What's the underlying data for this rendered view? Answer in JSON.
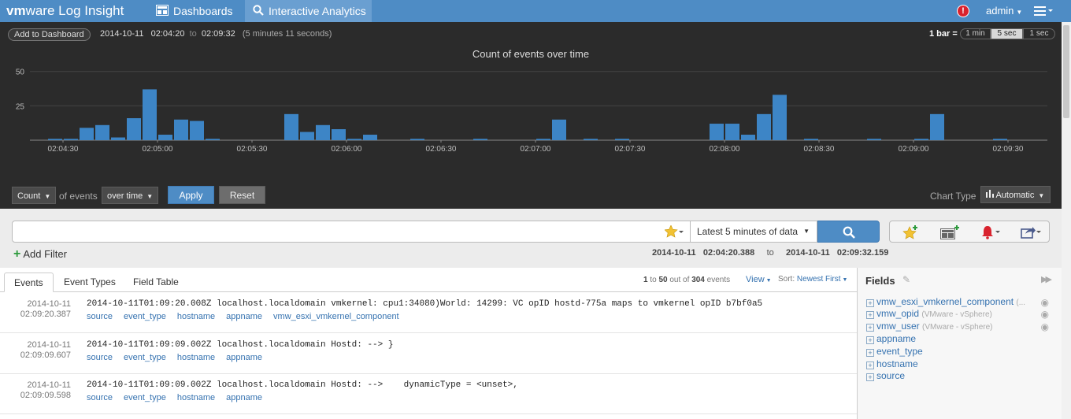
{
  "app": {
    "brand_bold": "vm",
    "brand_rest": "ware",
    "product": "Log Insight"
  },
  "nav": {
    "dashboards": "Dashboards",
    "interactive": "Interactive Analytics",
    "user": "admin",
    "alert_icon": "alert-icon",
    "menu_icon": "hamburger-menu-icon"
  },
  "chart_header": {
    "add_to_dashboard": "Add to Dashboard",
    "date": "2014-10-11",
    "start_time": "02:04:20",
    "to": "to",
    "end_time": "02:09:32",
    "duration": "(5 minutes 11 seconds)",
    "bar_label": "1 bar =",
    "bar_options": [
      "1 min",
      "5 sec",
      "1 sec"
    ],
    "selected_bar": "5 sec"
  },
  "chart_data": {
    "type": "bar",
    "title": "Count of events over time",
    "ylim": [
      0,
      55
    ],
    "y_ticks": [
      25,
      50
    ],
    "x_start_seconds": 260,
    "bin_seconds": 5,
    "x_tick_labels": [
      "02:04:30",
      "02:05:00",
      "02:05:30",
      "02:06:00",
      "02:06:30",
      "02:07:00",
      "02:07:30",
      "02:08:00",
      "02:08:30",
      "02:09:00",
      "02:09:30"
    ],
    "x_tick_seconds": [
      270,
      300,
      330,
      360,
      390,
      420,
      450,
      480,
      510,
      540,
      570
    ],
    "values": [
      0,
      1,
      1,
      9,
      11,
      2,
      16,
      37,
      4,
      15,
      14,
      1,
      0,
      0,
      0,
      0,
      19,
      6,
      11,
      8,
      1,
      4,
      0,
      0,
      1,
      0,
      0,
      0,
      1,
      0,
      0,
      0,
      1,
      15,
      0,
      1,
      0,
      1,
      0,
      0,
      0,
      0,
      0,
      12,
      12,
      4,
      19,
      33,
      0,
      1,
      0,
      0,
      0,
      1,
      0,
      0,
      1,
      19,
      0,
      0,
      0,
      1,
      0
    ]
  },
  "controls": {
    "function": "Count",
    "of_events": "of events",
    "grouping": "over time",
    "apply": "Apply",
    "reset": "Reset",
    "chart_type_label": "Chart Type",
    "chart_type": "Automatic"
  },
  "search": {
    "query": "",
    "time_range": "Latest 5 minutes of data",
    "add_filter": "Add Filter",
    "range_date_start": "2014-10-11",
    "range_time_start": "02:04:20.388",
    "range_to": "to",
    "range_date_end": "2014-10-11",
    "range_time_end": "02:09:32.159"
  },
  "results": {
    "tabs": [
      "Events",
      "Event Types",
      "Field Table"
    ],
    "active_tab": "Events",
    "range_start": "1",
    "to": "to",
    "range_end": "50",
    "out_of": "out of",
    "total": "304",
    "events_word": "events",
    "view": "View",
    "sort_label": "Sort:",
    "sort_value": "Newest First",
    "events": [
      {
        "date": "2014-10-11",
        "time": "02:09:20.387",
        "text": "2014-10-11T01:09:20.008Z localhost.localdomain vmkernel: cpu1:34080)World: 14299: VC opID hostd-775a maps to vmkernel opID b7bf0a5",
        "fields": [
          "source",
          "event_type",
          "hostname",
          "appname",
          "vmw_esxi_vmkernel_component"
        ]
      },
      {
        "date": "2014-10-11",
        "time": "02:09:09.607",
        "text": "2014-10-11T01:09:09.002Z localhost.localdomain Hostd: --> }",
        "fields": [
          "source",
          "event_type",
          "hostname",
          "appname"
        ]
      },
      {
        "date": "2014-10-11",
        "time": "02:09:09.598",
        "text": "2014-10-11T01:09:09.002Z localhost.localdomain Hostd: -->    dynamicType = <unset>,",
        "fields": [
          "source",
          "event_type",
          "hostname",
          "appname"
        ]
      }
    ]
  },
  "fields_panel": {
    "title": "Fields",
    "items": [
      {
        "name": "vmw_esxi_vmkernel_component",
        "source": "(...",
        "eye": true
      },
      {
        "name": "vmw_opid",
        "source": "(VMware - vSphere)",
        "eye": true
      },
      {
        "name": "vmw_user",
        "source": "(VMware - vSphere)",
        "eye": true
      },
      {
        "name": "appname",
        "source": "",
        "eye": false
      },
      {
        "name": "event_type",
        "source": "",
        "eye": false
      },
      {
        "name": "hostname",
        "source": "",
        "eye": false
      },
      {
        "name": "source",
        "source": "",
        "eye": false
      }
    ]
  },
  "colors": {
    "accent": "#4e8cc5",
    "bar": "#3d85c6",
    "chart_bg": "#2b2b2b",
    "link": "#3572b0"
  }
}
